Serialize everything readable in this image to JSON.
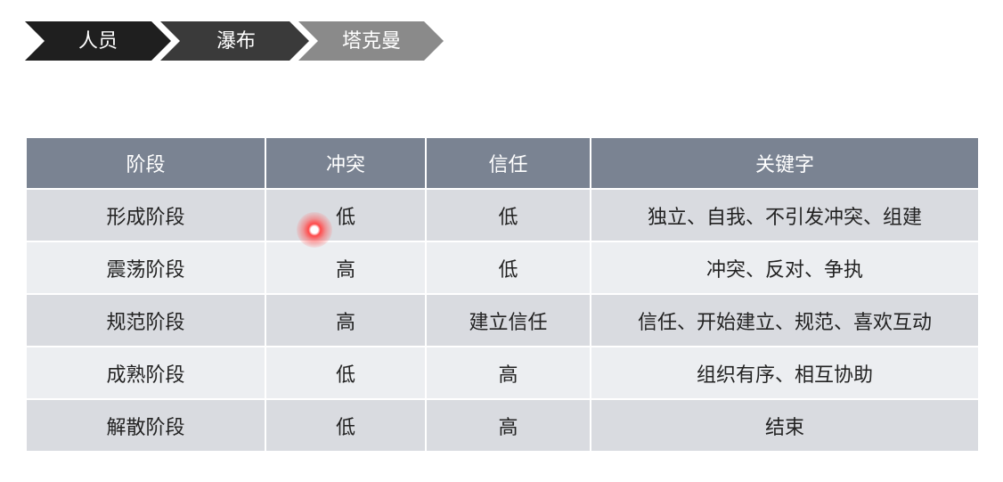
{
  "breadcrumb": {
    "items": [
      {
        "label": "人员",
        "color": "#1f1f1f"
      },
      {
        "label": "瀑布",
        "color": "#3a3a3a"
      },
      {
        "label": "塔克曼",
        "color": "#8a8a8a"
      }
    ]
  },
  "table": {
    "headers": [
      "阶段",
      "冲突",
      "信任",
      "关键字"
    ],
    "rows": [
      [
        "形成阶段",
        "低",
        "低",
        "独立、自我、不引发冲突、组建"
      ],
      [
        "震荡阶段",
        "高",
        "低",
        "冲突、反对、争执"
      ],
      [
        "规范阶段",
        "高",
        "建立信任",
        "信任、开始建立、规范、喜欢互动"
      ],
      [
        "成熟阶段",
        "低",
        "高",
        "组织有序、相互协助"
      ],
      [
        "解散阶段",
        "低",
        "高",
        "结束"
      ]
    ]
  },
  "colors": {
    "header_bg": "#7a8392",
    "row_odd": "#d9dbe0",
    "row_even": "#eceef1",
    "cursor_highlight": "#ff4a4a"
  }
}
